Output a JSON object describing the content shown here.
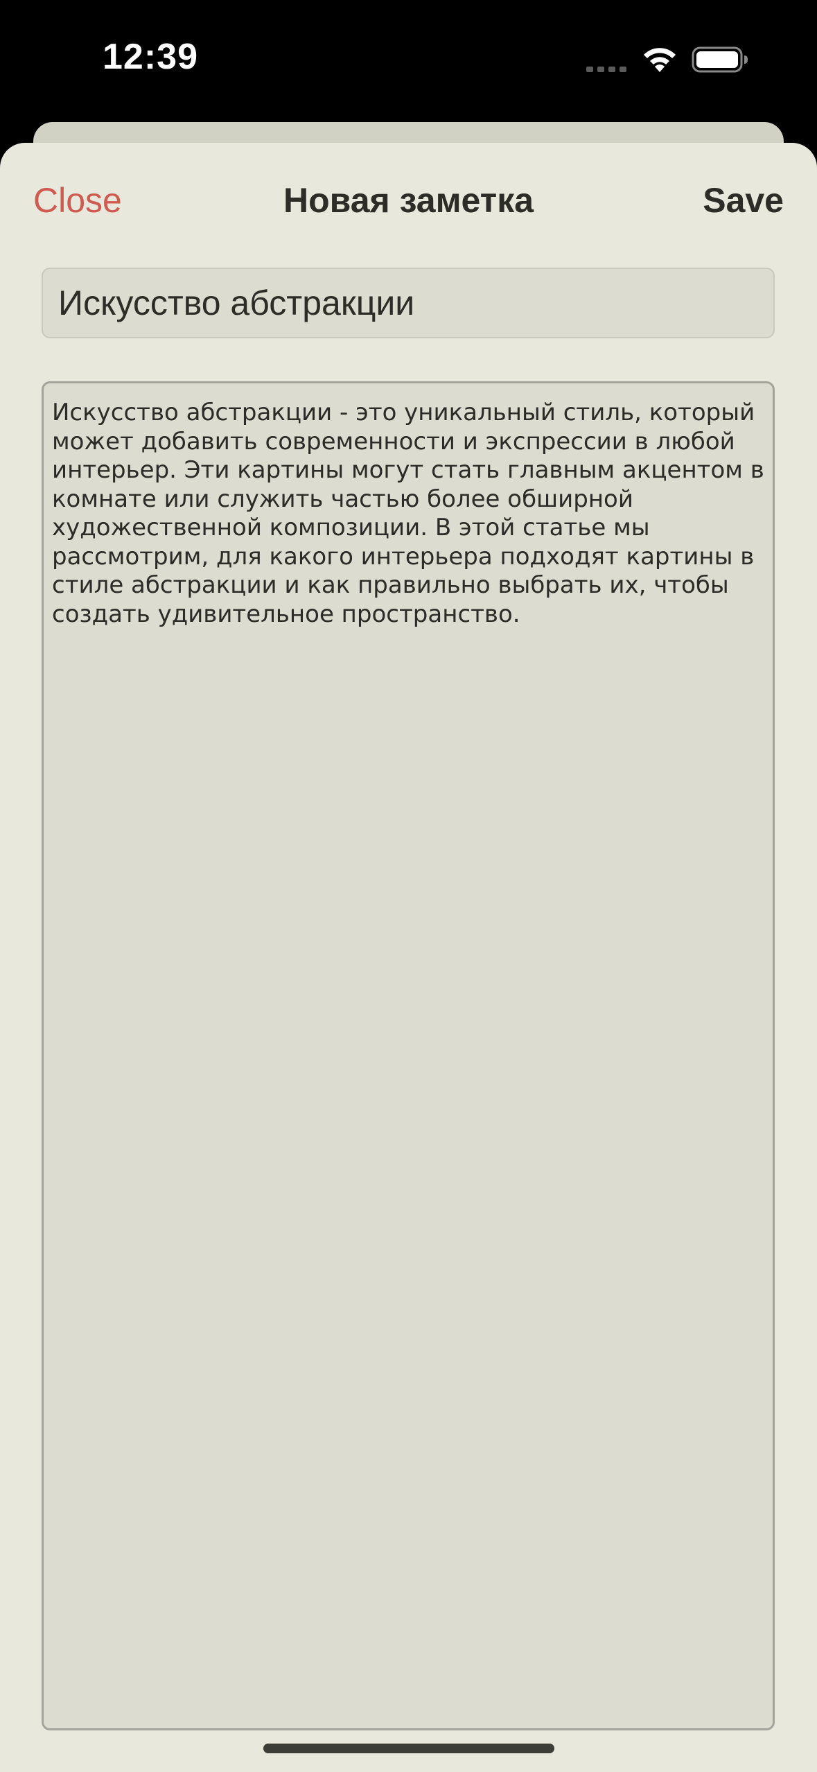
{
  "status_bar": {
    "time": "12:39",
    "icons": [
      "signal-dots-icon",
      "wifi-icon",
      "battery-icon"
    ]
  },
  "nav": {
    "close_label": "Close",
    "title": "Новая заметка",
    "save_label": "Save"
  },
  "note": {
    "title_value": "Искусство абстракции",
    "body_value": "Искусство абстракции - это уникальный стиль, который может добавить современности и экспрессии в любой интерьер. Эти картины могут стать главным акцентом в комнате или служить частью более обширной художественной композиции. В этой статье мы рассмотрим, для какого интерьера подходят картины в стиле абстракции и как правильно выбрать их, чтобы создать удивительное пространство."
  },
  "colors": {
    "background": "#e8e8dc",
    "field_background": "#dcdcd0",
    "close_accent": "#cf5a50",
    "text": "#2d2d28"
  }
}
